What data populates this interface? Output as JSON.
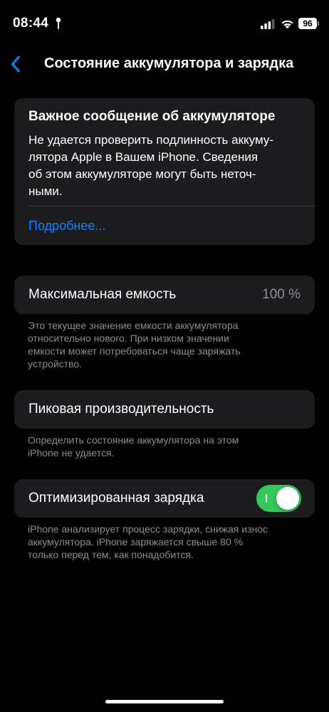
{
  "status_bar": {
    "time": "08:44",
    "battery_level": "96",
    "location_icon": "location-arrow",
    "signal_icon": "cellular-signal",
    "wifi_icon": "wifi"
  },
  "nav": {
    "back_icon": "chevron-left",
    "title": "Состояние аккумулятора и зарядка"
  },
  "alert": {
    "title": "Важное сообщение об аккумуляторе",
    "body_lines": [
      "Не удается проверить подлинность аккуму-",
      "лятора Apple в Вашем iPhone. Сведения",
      "об этом аккумуляторе могут быть неточ-",
      "ными."
    ],
    "link": "Подробнее..."
  },
  "max_capacity": {
    "label": "Максимальная емкость",
    "value": "100 %",
    "footnote_lines": [
      "Это текущее значение емкости аккумулятора",
      "относительно нового. При низком значении",
      "емкости может потребоваться чаще заряжать",
      "устройство."
    ]
  },
  "peak_performance": {
    "label": "Пиковая производительность",
    "footnote_lines": [
      "Определить состояние аккумулятора на этом",
      "iPhone не удается."
    ]
  },
  "optimized_charging": {
    "label": "Оптимизированная зарядка",
    "enabled": true,
    "footnote_lines": [
      "iPhone анализирует процесс зарядки, снижая износ",
      "аккумулятора. iPhone заряжается свыше 80 %",
      "только перед тем, как понадобится."
    ]
  },
  "colors": {
    "background": "#000000",
    "card": "#1c1c1e",
    "accent": "#0a84ff",
    "toggle_on": "#34c759",
    "secondary_text": "#8e8e93"
  }
}
